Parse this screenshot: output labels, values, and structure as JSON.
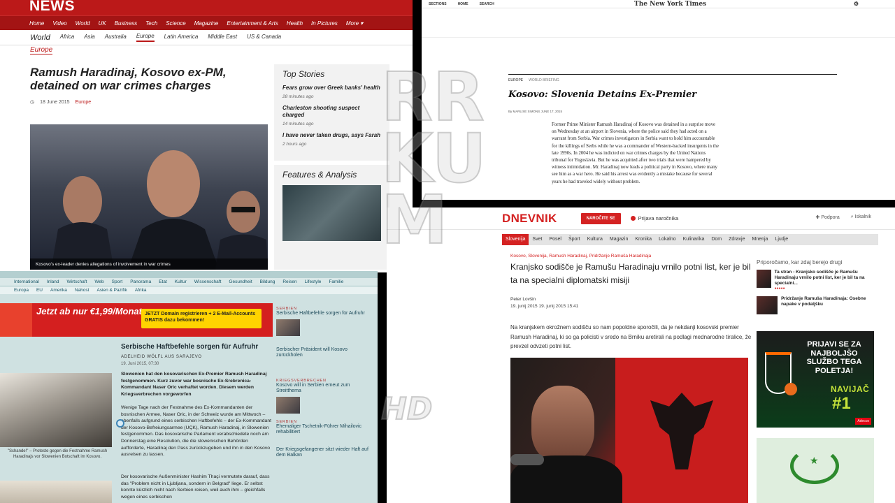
{
  "bbc": {
    "brand": "NEWS",
    "nav": [
      "Home",
      "Video",
      "World",
      "UK",
      "Business",
      "Tech",
      "Science",
      "Magazine",
      "Entertainment & Arts",
      "Health",
      "In Pictures",
      "More ▾"
    ],
    "world": "World",
    "subnav": [
      "Africa",
      "Asia",
      "Australia",
      "Europe",
      "Latin America",
      "Middle East",
      "US & Canada"
    ],
    "section": "Europe",
    "headline": "Ramush Haradinaj, Kosovo ex-PM, detained on war crimes charges",
    "date": "18 June 2015",
    "category": "Europe",
    "photo_caption": "Kosovo's ex-leader denies allegations of involvement in war crimes",
    "top_stories_title": "Top Stories",
    "stories": [
      {
        "title": "Fears grow over Greek banks' health",
        "ago": "28 minutes ago"
      },
      {
        "title": "Charleston shooting suspect charged",
        "ago": "14 minutes ago"
      },
      {
        "title": "I have never taken drugs, says Farah",
        "ago": "2 hours ago"
      }
    ],
    "features_title": "Features & Analysis"
  },
  "nyt": {
    "bar": [
      "SECTIONS",
      "HOME",
      "SEARCH"
    ],
    "logo": "The New York Times",
    "kicker": "EUROPE",
    "kicker_sub": "WORLD BRIEFING",
    "headline": "Kosovo: Slovenia Detains Ex-Premier",
    "byline": "By MARLISE SIMONS   JUNE 17, 2015",
    "body": "Former Prime Minister Ramush Haradinaj of Kosovo was detained in a surprise move on Wednesday at an airport in Slovenia, where the police said they had acted on a warrant from Serbia. War crimes investigators in Serbia want to hold him accountable for the killings of Serbs while he was a commander of Western-backed insurgents in the late 1990s. In 2004 he was indicted on war crimes charges by the United Nations tribunal for Yugoslavia. But he was acquitted after two trials that were hampered by witness intimidation. Mr. Haradinaj now leads a political party in Kosovo, where many see him as a war hero. He said his arrest was evidently a mistake because for several years he had traveled widely without problem."
  },
  "standard": {
    "nav1": [
      "International",
      "Inland",
      "Wirtschaft",
      "Web",
      "Sport",
      "Panorama",
      "Etat",
      "Kultur",
      "Wissenschaft",
      "Gesundheit",
      "Bildung",
      "Reisen",
      "Lifestyle",
      "Familie"
    ],
    "nav2": [
      "Europa",
      "EU",
      "Amerika",
      "Nahost",
      "Asien & Pazifik",
      "Afrika"
    ],
    "ad_main": "Jetzt ab nur €1,99/Monat",
    "ad_promo": "JETZT Domain registrieren + 2 E-Mail-Accounts GRATIS dazu bekommen!",
    "title": "Serbische Haftbefehle sorgen für Aufruhr",
    "author": "ADELHEID WÖLFL AUS SARAJEVO",
    "date": "19. Juni 2015, 07:30",
    "lead": "Slowenien hat den kosovarischen Ex-Premier Ramush Haradinaj festgenommen. Kurz zuvor war bosnische Ex-Srebrenica-Kommandant Naser Oric verhaftet worden. Diesem werden Kriegsverbrechen vorgeworfen",
    "body": "Wenige Tage nach der Festnahme des Ex-Kommandanten der bosnischen Armee, Naser Oric, in der Schweiz wurde am Mittwoch – ebenfalls aufgrund eines serbischen Haftbefehls – der Ex-Kommandant der Kosovo-Befreiungsarmee (UÇK), Ramush Haradinaj, in Slowenien festgenommen. Das kosovarische Parlament verabschiedete noch am Donnerstag eine Resolution, die die slowenischen Behörden aufforderte, Haradinaj den Pass zurückzugeben und ihn in den Kosovo ausreisen zu lassen.",
    "body2": "Der kosovarische Außenminister Hashim Thaçi vermutete darauf, dass das \"Problem nicht in Ljubljana, sondern in Belgrad\" liege. Er selbst konnte kürzlich nicht nach Serbien reisen, weil auch ihm – gleichfalls wegen eines serbischen",
    "photo_caption": "\"Schande!\" – Proteste gegen die Festnahme Ramush Haradinajs vor Slowenien Botschaft im Kosovo.",
    "side_label1": "SERBIEN",
    "side_story1": "Serbische Haftbefehle sorgen für Aufruhr",
    "side_story2": "Serbischer Präsident will Kosovo zurückholen",
    "side_label2": "KRIEGSVERBRECHEN",
    "side_story3": "Kosovo will in Serbien erneut zum Streitthema",
    "side_label3": "SERBIEN",
    "side_story4": "Ehemaliger Tschetnik-Führer Mihailovic rehabilitiert",
    "side_story5": "Der Kriegsgefangener sitzt wieder Haft auf dem Balkan"
  },
  "dnevnik": {
    "logo": "DNEVNIK",
    "btn": "NAROČITE SE",
    "subscribe": "Prijava naročnika",
    "right": [
      "Podpora",
      "Iskalnik"
    ],
    "nav": [
      "Slovenija",
      "Svet",
      "Posel",
      "Šport",
      "Kultura",
      "Magazin",
      "Kronika",
      "Lokalno",
      "Kulinarika",
      "Dom",
      "Zdravje",
      "Mnenja",
      "Ljudje"
    ],
    "crumb": "Kosovo, Slovenija, Ramush Haradinaj, Pridržanje Ramuša Haradinaja",
    "title": "Kranjsko sodišče je Ramušu Haradinaju vrnilo potni list, ker je bil ta na specialni diplomatski misiji",
    "author": "Peter Lovšin",
    "date": "19. junij 2015   19. junij 2015 15:41",
    "lead": "Na kranjskem okrožnem sodišču so nam popoldne sporočili, da je nekdanji kosovski premier Ramush Haradinaj, ki so ga policisti v sredo na Brniku aretirali na podlagi mednarodne tiralice, že prevzel odvzeti potni list.",
    "rec_title": "Priporočamo, kar zdaj berejo drugi",
    "rec": [
      "Ta stran - Kranjsko sodišče je Ramušu Haradinaju vrnilo potni list, ker je bil ta na specialni...",
      "Pridržanje Ramuša Haradinaja: Osebne napake v podaljšku"
    ],
    "ad_text": "PRIJAVI SE ZA NAJBOLJŠO SLUŽBO TEGA POLETJA!",
    "ad_nav": "NAVIJAČ",
    "ad_one": "#1",
    "ad_brand": "Adecco"
  },
  "watermark": "RRKUM HD"
}
